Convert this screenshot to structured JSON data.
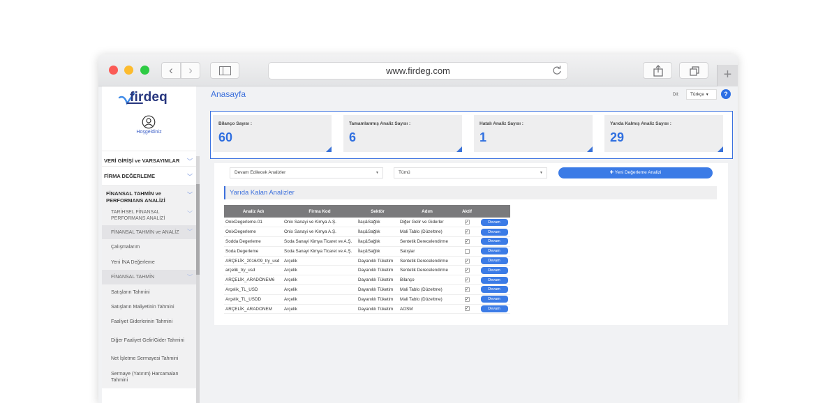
{
  "browser": {
    "url": "www.firdeg.com"
  },
  "sidebar": {
    "logo_text": "firdeq",
    "welcome": "Hoşgeldiniz",
    "items": [
      {
        "label": "VERİ GİRİŞİ ve VARSAYIMLAR"
      },
      {
        "label": "FİRMA DEĞERLEME"
      },
      {
        "label": "FİNANSAL TAHMİN ve PERFORMANS ANALİZİ"
      },
      {
        "label": "TARİHSEL FİNANSAL PERFORMANS ANALİZİ"
      },
      {
        "label": "FİNANSAL TAHMİN ve ANALİZ"
      },
      {
        "label": "Çalışmalarım"
      },
      {
        "label": "Yeni İNA Değerleme"
      },
      {
        "label": "FİNANSAL TAHMİN"
      },
      {
        "label": "Satışların Tahmini"
      },
      {
        "label": "Satışların Maliyetinin Tahmini"
      },
      {
        "label": "Faaliyet Giderlerinin Tahmini"
      },
      {
        "label": "Diğer Faaliyet Gelir/Gider Tahmini"
      },
      {
        "label": "Net İşletme Sermayesi Tahmini"
      },
      {
        "label": "Sermaye (Yatırım) Harcamaları Tahmini"
      }
    ]
  },
  "header": {
    "title": "Anasayfa",
    "lang_label": "Dil:",
    "lang_value": "Türkçe",
    "help": "?"
  },
  "stats": [
    {
      "label": "Bilanço Sayısı :",
      "value": "60"
    },
    {
      "label": "Tamamlanmış Analiz Sayısı :",
      "value": "6"
    },
    {
      "label": "Hatalı Analiz Sayısı :",
      "value": "1"
    },
    {
      "label": "Yarıda Kalmış Analiz Sayısı :",
      "value": "29"
    }
  ],
  "filters": {
    "analysis_select": "Devam Edilecek Analizler",
    "scope_select": "Tümü",
    "new_button": "Yeni Değerleme Analizi"
  },
  "section_title": "Yarıda Kalan Analizler",
  "table": {
    "headers": [
      "Analiz Adı",
      "Firma Kod",
      "Sektör",
      "Adım",
      "Aktif",
      ""
    ],
    "action_label": "Devam",
    "rows": [
      {
        "name": "OnixDegerleme-01",
        "firma": "Onix Sanayi ve Kimya A.Ş.",
        "sektor": "İlaç&Sağlık",
        "adim": "Diğer Gelir ve Giderler",
        "aktif": true
      },
      {
        "name": "OnixDegerleme",
        "firma": "Onix Sanayi ve Kimya A.Ş.",
        "sektor": "İlaç&Sağlık",
        "adim": "Mali Tablo (Düzeltme)",
        "aktif": true
      },
      {
        "name": "Sodda Degerleme",
        "firma": "Soda Sanayi Kimya Ticaret ve A.Ş.",
        "sektor": "İlaç&Sağlık",
        "adim": "Sentetik Derecelendirme",
        "aktif": true
      },
      {
        "name": "Soda Degerleme",
        "firma": "Soda Sanayi Kimya Ticaret ve A.Ş.",
        "sektor": "İlaç&Sağlık",
        "adim": "Satışlar",
        "aktif": false
      },
      {
        "name": "ARÇELİK_2016/09_try_usd",
        "firma": "Arçelik",
        "sektor": "Dayanıklı Tüketim",
        "adim": "Sentetik Derecelendirme",
        "aktif": true
      },
      {
        "name": "arçelik_try_usd",
        "firma": "Arçelik",
        "sektor": "Dayanıklı Tüketim",
        "adim": "Sentetik Derecelendirme",
        "aktif": true
      },
      {
        "name": "ARÇELİK_ARADÖNEM6",
        "firma": "Arçelik",
        "sektor": "Dayanıklı Tüketim",
        "adim": "Bilanço",
        "aktif": true
      },
      {
        "name": "Arçelik_TL_USD",
        "firma": "Arçelik",
        "sektor": "Dayanıklı Tüketim",
        "adim": "Mali Tablo (Düzeltme)",
        "aktif": true
      },
      {
        "name": "Arçelik_TL_USDD",
        "firma": "Arçelik",
        "sektor": "Dayanıklı Tüketim",
        "adim": "Mali Tablo (Düzeltme)",
        "aktif": true
      },
      {
        "name": "ARÇELİK_ARADONEM",
        "firma": "Arçelik",
        "sektor": "Dayanıklı Tüketim",
        "adim": "AOSM",
        "aktif": true
      }
    ]
  },
  "colors": {
    "accent": "#3b7be6",
    "brand": "#27367e"
  }
}
